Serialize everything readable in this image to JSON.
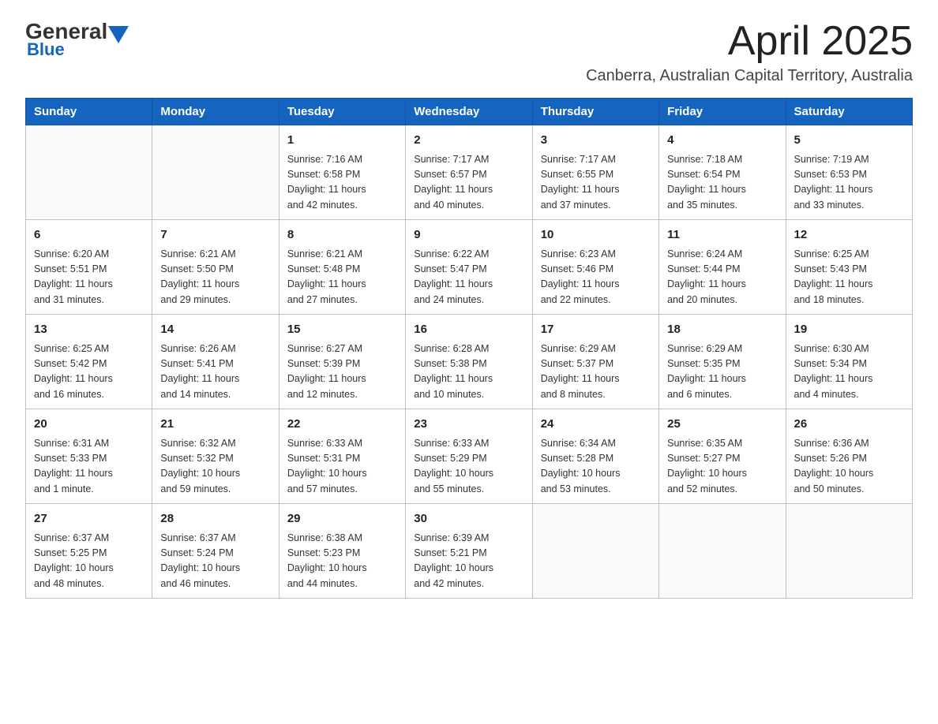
{
  "header": {
    "logo_general": "General",
    "logo_blue": "Blue",
    "month_title": "April 2025",
    "subtitle": "Canberra, Australian Capital Territory, Australia"
  },
  "weekdays": [
    "Sunday",
    "Monday",
    "Tuesday",
    "Wednesday",
    "Thursday",
    "Friday",
    "Saturday"
  ],
  "weeks": [
    [
      {
        "day": "",
        "info": ""
      },
      {
        "day": "",
        "info": ""
      },
      {
        "day": "1",
        "info": "Sunrise: 7:16 AM\nSunset: 6:58 PM\nDaylight: 11 hours\nand 42 minutes."
      },
      {
        "day": "2",
        "info": "Sunrise: 7:17 AM\nSunset: 6:57 PM\nDaylight: 11 hours\nand 40 minutes."
      },
      {
        "day": "3",
        "info": "Sunrise: 7:17 AM\nSunset: 6:55 PM\nDaylight: 11 hours\nand 37 minutes."
      },
      {
        "day": "4",
        "info": "Sunrise: 7:18 AM\nSunset: 6:54 PM\nDaylight: 11 hours\nand 35 minutes."
      },
      {
        "day": "5",
        "info": "Sunrise: 7:19 AM\nSunset: 6:53 PM\nDaylight: 11 hours\nand 33 minutes."
      }
    ],
    [
      {
        "day": "6",
        "info": "Sunrise: 6:20 AM\nSunset: 5:51 PM\nDaylight: 11 hours\nand 31 minutes."
      },
      {
        "day": "7",
        "info": "Sunrise: 6:21 AM\nSunset: 5:50 PM\nDaylight: 11 hours\nand 29 minutes."
      },
      {
        "day": "8",
        "info": "Sunrise: 6:21 AM\nSunset: 5:48 PM\nDaylight: 11 hours\nand 27 minutes."
      },
      {
        "day": "9",
        "info": "Sunrise: 6:22 AM\nSunset: 5:47 PM\nDaylight: 11 hours\nand 24 minutes."
      },
      {
        "day": "10",
        "info": "Sunrise: 6:23 AM\nSunset: 5:46 PM\nDaylight: 11 hours\nand 22 minutes."
      },
      {
        "day": "11",
        "info": "Sunrise: 6:24 AM\nSunset: 5:44 PM\nDaylight: 11 hours\nand 20 minutes."
      },
      {
        "day": "12",
        "info": "Sunrise: 6:25 AM\nSunset: 5:43 PM\nDaylight: 11 hours\nand 18 minutes."
      }
    ],
    [
      {
        "day": "13",
        "info": "Sunrise: 6:25 AM\nSunset: 5:42 PM\nDaylight: 11 hours\nand 16 minutes."
      },
      {
        "day": "14",
        "info": "Sunrise: 6:26 AM\nSunset: 5:41 PM\nDaylight: 11 hours\nand 14 minutes."
      },
      {
        "day": "15",
        "info": "Sunrise: 6:27 AM\nSunset: 5:39 PM\nDaylight: 11 hours\nand 12 minutes."
      },
      {
        "day": "16",
        "info": "Sunrise: 6:28 AM\nSunset: 5:38 PM\nDaylight: 11 hours\nand 10 minutes."
      },
      {
        "day": "17",
        "info": "Sunrise: 6:29 AM\nSunset: 5:37 PM\nDaylight: 11 hours\nand 8 minutes."
      },
      {
        "day": "18",
        "info": "Sunrise: 6:29 AM\nSunset: 5:35 PM\nDaylight: 11 hours\nand 6 minutes."
      },
      {
        "day": "19",
        "info": "Sunrise: 6:30 AM\nSunset: 5:34 PM\nDaylight: 11 hours\nand 4 minutes."
      }
    ],
    [
      {
        "day": "20",
        "info": "Sunrise: 6:31 AM\nSunset: 5:33 PM\nDaylight: 11 hours\nand 1 minute."
      },
      {
        "day": "21",
        "info": "Sunrise: 6:32 AM\nSunset: 5:32 PM\nDaylight: 10 hours\nand 59 minutes."
      },
      {
        "day": "22",
        "info": "Sunrise: 6:33 AM\nSunset: 5:31 PM\nDaylight: 10 hours\nand 57 minutes."
      },
      {
        "day": "23",
        "info": "Sunrise: 6:33 AM\nSunset: 5:29 PM\nDaylight: 10 hours\nand 55 minutes."
      },
      {
        "day": "24",
        "info": "Sunrise: 6:34 AM\nSunset: 5:28 PM\nDaylight: 10 hours\nand 53 minutes."
      },
      {
        "day": "25",
        "info": "Sunrise: 6:35 AM\nSunset: 5:27 PM\nDaylight: 10 hours\nand 52 minutes."
      },
      {
        "day": "26",
        "info": "Sunrise: 6:36 AM\nSunset: 5:26 PM\nDaylight: 10 hours\nand 50 minutes."
      }
    ],
    [
      {
        "day": "27",
        "info": "Sunrise: 6:37 AM\nSunset: 5:25 PM\nDaylight: 10 hours\nand 48 minutes."
      },
      {
        "day": "28",
        "info": "Sunrise: 6:37 AM\nSunset: 5:24 PM\nDaylight: 10 hours\nand 46 minutes."
      },
      {
        "day": "29",
        "info": "Sunrise: 6:38 AM\nSunset: 5:23 PM\nDaylight: 10 hours\nand 44 minutes."
      },
      {
        "day": "30",
        "info": "Sunrise: 6:39 AM\nSunset: 5:21 PM\nDaylight: 10 hours\nand 42 minutes."
      },
      {
        "day": "",
        "info": ""
      },
      {
        "day": "",
        "info": ""
      },
      {
        "day": "",
        "info": ""
      }
    ]
  ]
}
